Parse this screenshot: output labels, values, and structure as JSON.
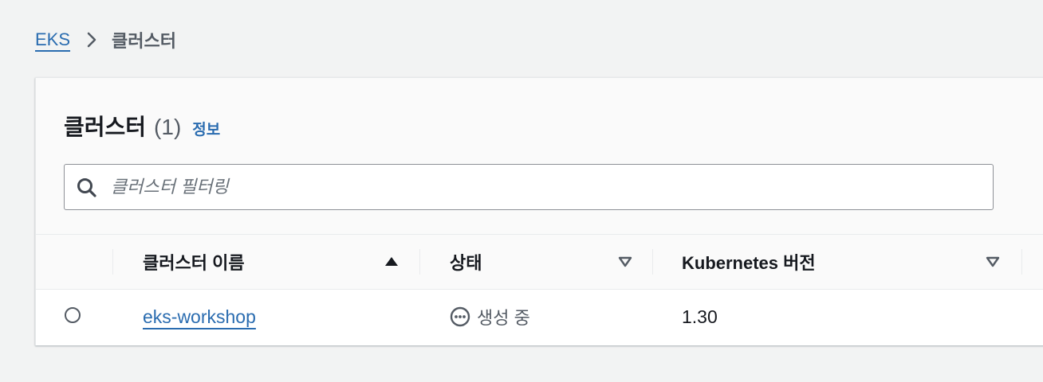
{
  "breadcrumb": {
    "root": "EKS",
    "current": "클러스터"
  },
  "panel": {
    "title": "클러스터",
    "count": "(1)",
    "info_link": "정보",
    "search": {
      "placeholder": "클러스터 필터링",
      "value": ""
    }
  },
  "table": {
    "columns": [
      {
        "label": "클러스터 이름",
        "sort": "ascending"
      },
      {
        "label": "상태",
        "sort": "none"
      },
      {
        "label": "Kubernetes 버전",
        "sort": "none"
      }
    ],
    "rows": [
      {
        "name": "eks-workshop",
        "status": "생성 중",
        "version": "1.30",
        "selected": false
      }
    ]
  },
  "colors": {
    "link": "#2a6cb0",
    "text": "#16191f",
    "muted": "#545b64",
    "background": "#f2f3f3"
  },
  "icons": {
    "separator": "chevron-right-icon",
    "search": "search-icon",
    "sort_asc": "sort-ascending-icon",
    "sort_none": "sort-descending-outline-icon",
    "status": "in-progress-icon"
  }
}
